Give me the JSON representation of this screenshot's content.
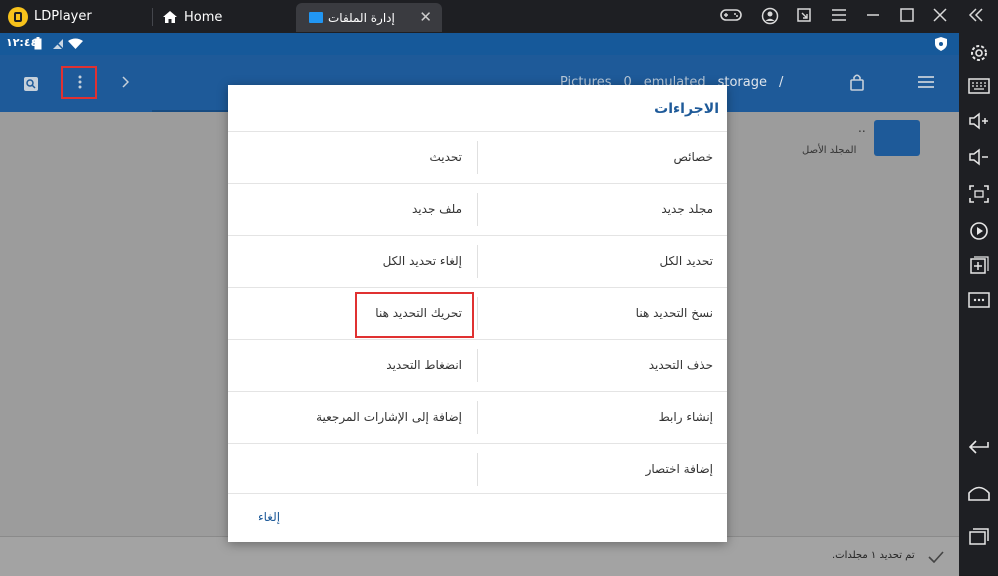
{
  "titlebar": {
    "app_name": "LDPlayer",
    "home_tab": "Home",
    "active_tab": "إدارة الملفات",
    "close_symbol": "✕"
  },
  "statusbar": {
    "time": "١٢:٤٤"
  },
  "appbar": {
    "breadcrumbs": [
      "Pictures",
      "0",
      "emulated",
      "storage",
      "/"
    ]
  },
  "file_list": {
    "parent_name": "..",
    "parent_label": "المجلد الأصل"
  },
  "bottom": {
    "selection_text": "تم تحديد ١ مجلدات."
  },
  "dialog": {
    "title": "الاجراءات",
    "rows": [
      {
        "right": "خصائص",
        "left": "تحديث"
      },
      {
        "right": "مجلد جديد",
        "left": "ملف جديد"
      },
      {
        "right": "تحديد الكل",
        "left": "إلغاء تحديد الكل"
      },
      {
        "right": "نسخ التحديد هنا",
        "left": "تحريك التحديد هنا"
      },
      {
        "right": "حذف التحديد",
        "left": "انضغاط التحديد"
      },
      {
        "right": "إنشاء رابط",
        "left": "إضافة إلى الإشارات المرجعية"
      },
      {
        "right": "إضافة اختصار",
        "left": ""
      }
    ],
    "cancel": "إلغاء"
  },
  "colors": {
    "accent": "#1e5a99",
    "highlight": "#e03131"
  }
}
